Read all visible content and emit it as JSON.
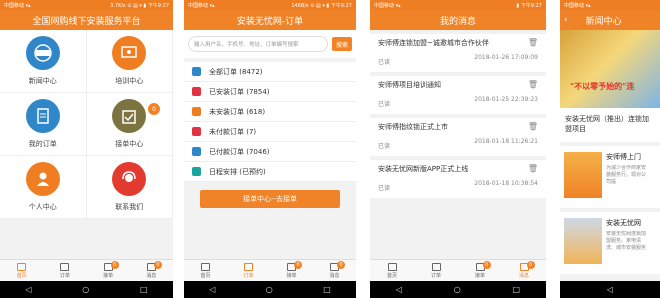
{
  "home": {
    "status_left": "中国移动 ▾▴",
    "status_right": "3.7K/s ⊙ ▤ ▾ ▮ 下午9:27",
    "title": "全国网购线下安装服务平台",
    "cells": [
      {
        "label": "新闻中心",
        "icon": "news-icon",
        "color": "#2f86c8"
      },
      {
        "label": "培训中心",
        "icon": "training-icon",
        "color": "#ef7d22"
      },
      {
        "label": "我的订单",
        "icon": "orders-icon",
        "color": "#2f86c8"
      },
      {
        "label": "接单中心",
        "icon": "accept-order-icon",
        "color": "#7c7440",
        "badge": "0"
      },
      {
        "label": "个人中心",
        "icon": "profile-icon",
        "color": "#ef7d22"
      },
      {
        "label": "联系我们",
        "icon": "contact-icon",
        "color": "#e33b2f"
      }
    ]
  },
  "tabs": [
    {
      "label": "首页",
      "name": "home"
    },
    {
      "label": "订单",
      "name": "orders"
    },
    {
      "label": "接单",
      "name": "accept"
    },
    {
      "label": "消息",
      "name": "messages"
    }
  ],
  "orders": {
    "status_left": "中国移动 ▾▴",
    "status_right": "146B/s ⊙ ▤ ▾ ▮ 下午9:27",
    "title": "安装无忧网-订单",
    "search_placeholder": "输入用户名、手机号、地址、订单编号搜索",
    "search_button": "搜索",
    "items": [
      {
        "label": "全部订单 (8472)",
        "color": "#2f86c8"
      },
      {
        "label": "已安装订单 (7854)",
        "color": "#e3313f"
      },
      {
        "label": "未安装订单 (618)",
        "color": "#ef7d22"
      },
      {
        "label": "未付款订单 (7)",
        "color": "#e3313f"
      },
      {
        "label": "已付款订单 (7046)",
        "color": "#2f86c8"
      },
      {
        "label": "日程安排 (已预约)",
        "color": "#1ba3a0"
      }
    ],
    "cta": "接单中心--去接单"
  },
  "messages": {
    "title": "我的消息",
    "items": [
      {
        "title": "安师傅连锁加盟~诚邀城市合作伙伴",
        "read": "已读",
        "time": "2018-01-26 17:09:09"
      },
      {
        "title": "安师傅项目培训通知",
        "read": "已读",
        "time": "2018-01-25 22:39:23"
      },
      {
        "title": "安师傅指纹锁正式上市",
        "read": "已读",
        "time": "2018-01-18 11:26:21"
      },
      {
        "title": "安装无忧网新版APP正式上线",
        "read": "已读",
        "time": "2018-01-18 10:38:54"
      }
    ]
  },
  "news": {
    "status": "中国移动 ▾▴",
    "title": "新闻中心",
    "hero_text": "\"不以零予始的\"连",
    "headline": "安装无忧网（推出）连锁加盟项目",
    "items": [
      {
        "title": "安师傅上门",
        "desc": "为减少合作商家安装服务行。现对公司提"
      },
      {
        "title": "安装无忧网",
        "desc": "安装无忧网连锁加盟服务。家电清洗、城市安装服务"
      }
    ]
  }
}
